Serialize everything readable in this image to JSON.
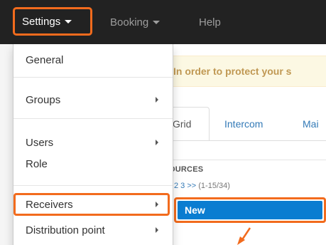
{
  "navbar": {
    "settings_label": "Settings",
    "booking_label": "Booking",
    "help_label": "Help"
  },
  "dropdown": {
    "items": [
      {
        "label": "General",
        "has_submenu": false
      },
      {
        "label": "Groups",
        "has_submenu": true
      },
      {
        "label": "Users",
        "has_submenu": true
      },
      {
        "label": "Role",
        "has_submenu": false
      },
      {
        "label": "Receivers",
        "has_submenu": true
      },
      {
        "label": "Distribution point",
        "has_submenu": true
      }
    ]
  },
  "page": {
    "alert_text": "In order to protect your s",
    "tabs": [
      "Grid",
      "Intercom",
      "Mai"
    ],
    "resources_label": "OURCES",
    "pager": {
      "pages": "2 3 >>",
      "range": "(1-15/34)"
    },
    "new_button_label": "New"
  },
  "colors": {
    "navbar_bg": "#222222",
    "highlight_orange": "#f26b1d",
    "new_button_blue": "#0a7dd1",
    "alert_bg": "#fcf8e3",
    "link_blue": "#337ab7"
  },
  "icons": {
    "caret": "caret-down-icon",
    "submenu": "chevron-right-icon",
    "arrow": "arrow-down-left-icon"
  }
}
